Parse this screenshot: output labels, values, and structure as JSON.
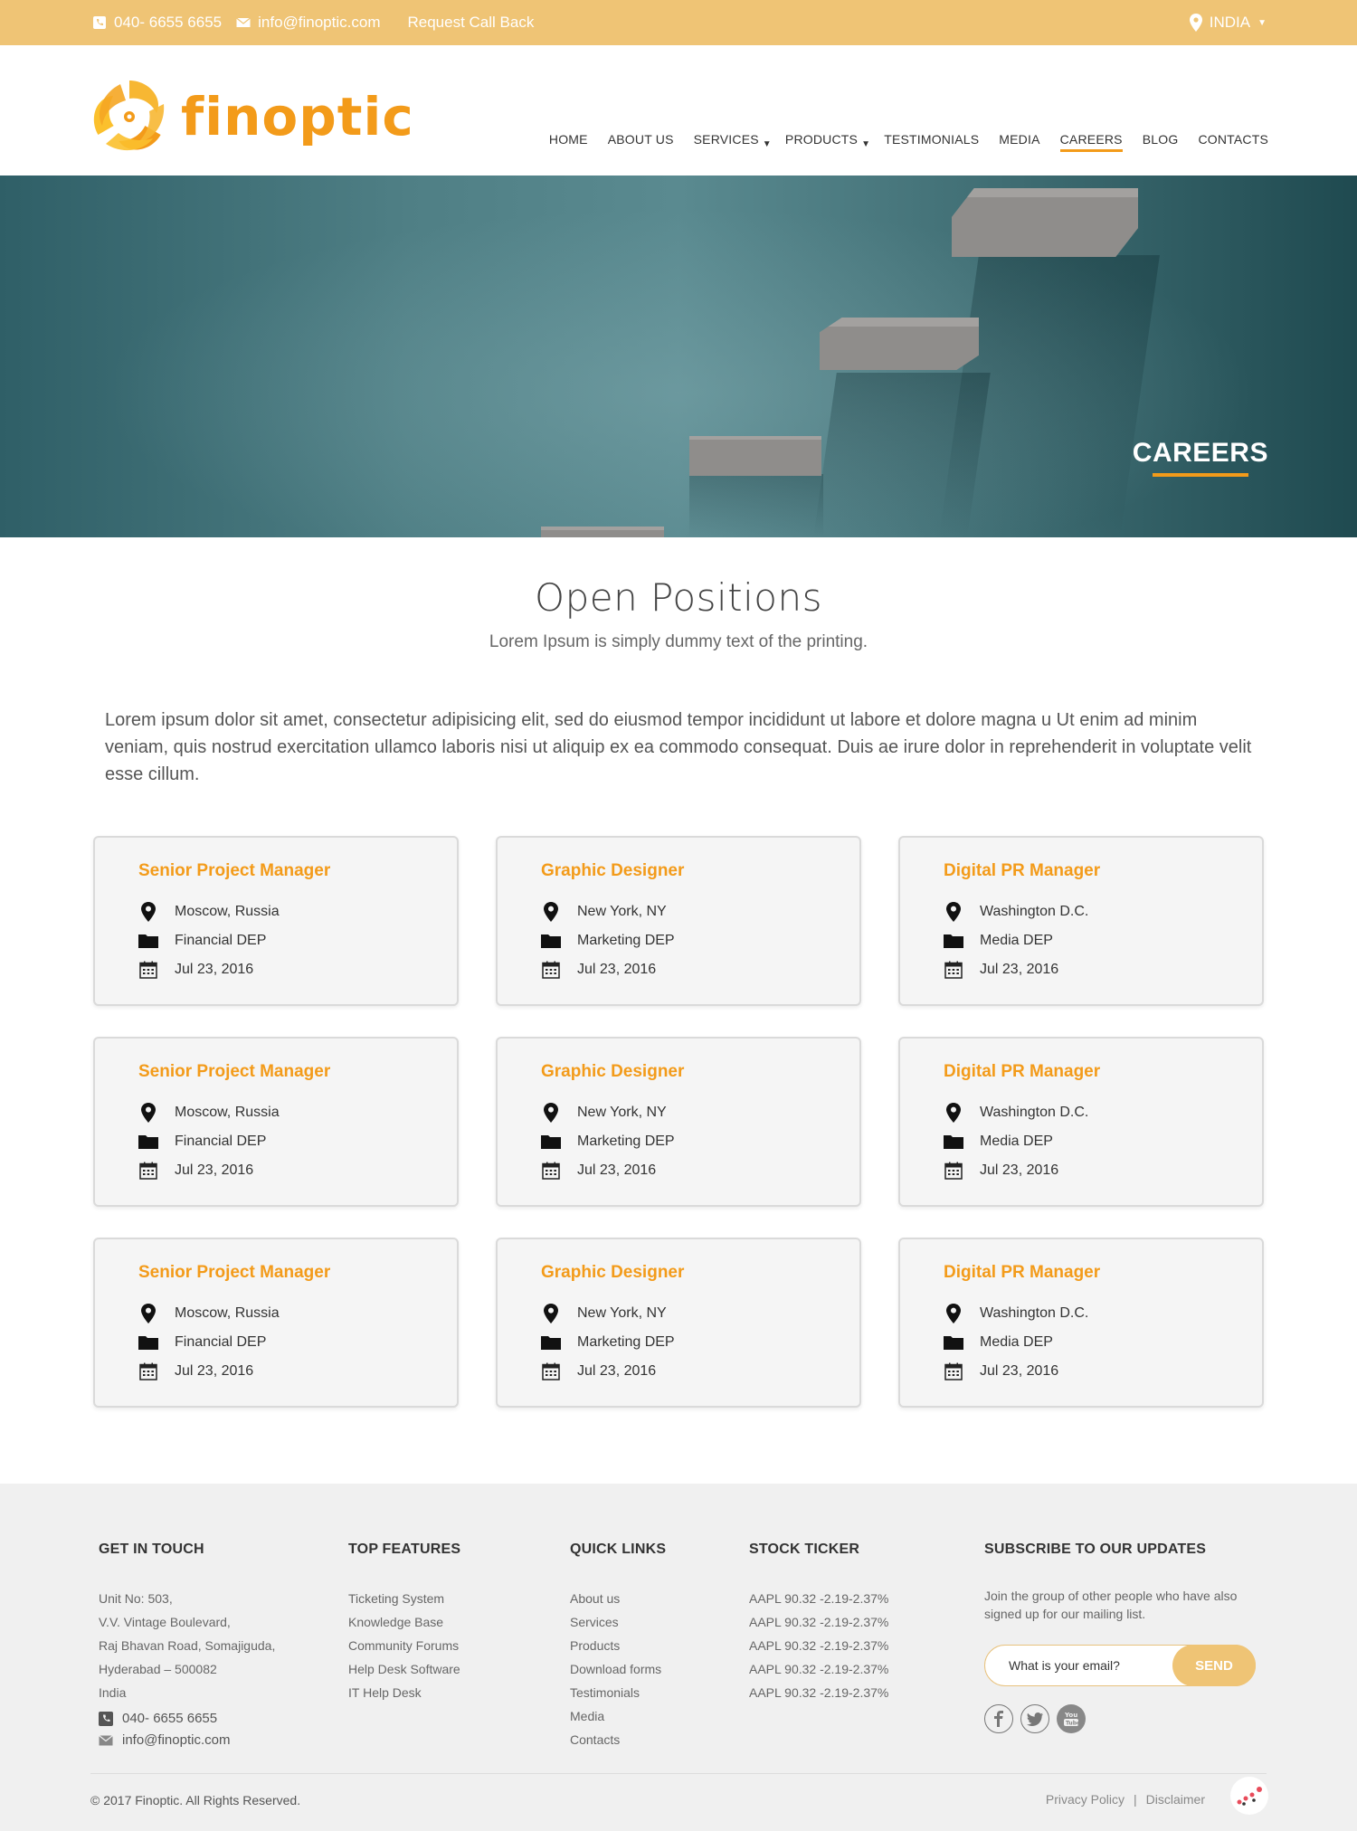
{
  "topbar": {
    "phone": "040- 6655 6655",
    "email": "info@finoptic.com",
    "callback": "Request Call Back",
    "country": "INDIA"
  },
  "brand": {
    "name": "finoptic",
    "color": "#f39b1a",
    "accent": "#efc475"
  },
  "nav": {
    "items": [
      {
        "label": "HOME"
      },
      {
        "label": "ABOUT US"
      },
      {
        "label": "SERVICES"
      },
      {
        "label": "PRODUCTS"
      },
      {
        "label": "TESTIMONIALS"
      },
      {
        "label": "MEDIA"
      },
      {
        "label": "CAREERS"
      },
      {
        "label": "BLOG"
      },
      {
        "label": "CONTACTS"
      }
    ]
  },
  "hero": {
    "title": "CAREERS"
  },
  "positions": {
    "title": "Open Positions",
    "subtitle": "Lorem Ipsum is simply dummy text of the printing.",
    "intro": "Lorem ipsum dolor sit amet, consectetur adipisicing elit, sed do eiusmod tempor incididunt ut labore et dolore  magna u  Ut  enim ad minim veniam, quis nostrud exercitation ullamco laboris nisi ut aliquip ex ea commodo consequat. Duis ae irure dolor in reprehenderit in voluptate velit esse cillum.",
    "cards": [
      {
        "title": "Senior Project Manager",
        "location": "Moscow, Russia",
        "dept": "Financial DEP",
        "date": "Jul 23, 2016"
      },
      {
        "title": "Graphic Designer",
        "location": "New York, NY",
        "dept": "Marketing DEP",
        "date": "Jul 23, 2016"
      },
      {
        "title": "Digital PR Manager",
        "location": "Washington D.C.",
        "dept": "Media DEP",
        "date": "Jul 23, 2016"
      },
      {
        "title": "Senior Project Manager",
        "location": "Moscow, Russia",
        "dept": "Financial DEP",
        "date": "Jul 23, 2016"
      },
      {
        "title": "Graphic Designer",
        "location": "New York, NY",
        "dept": "Marketing DEP",
        "date": "Jul 23, 2016"
      },
      {
        "title": "Digital PR Manager",
        "location": "Washington D.C.",
        "dept": "Media DEP",
        "date": "Jul 23, 2016"
      },
      {
        "title": "Senior Project Manager",
        "location": "Moscow, Russia",
        "dept": "Financial DEP",
        "date": "Jul 23, 2016"
      },
      {
        "title": "Graphic Designer",
        "location": "New York, NY",
        "dept": "Marketing DEP",
        "date": "Jul 23, 2016"
      },
      {
        "title": "Digital PR Manager",
        "location": "Washington D.C.",
        "dept": "Media DEP",
        "date": "Jul 23, 2016"
      }
    ]
  },
  "footer": {
    "contact": {
      "heading": "GET IN TOUCH",
      "address": [
        "Unit No: 503,",
        "V.V. Vintage Boulevard,",
        "Raj Bhavan Road, Somajiguda,",
        "Hyderabad – 500082",
        "India"
      ],
      "phone": "040- 6655 6655",
      "email": "info@finoptic.com"
    },
    "features": {
      "heading": "TOP FEATURES",
      "items": [
        "Ticketing System",
        "Knowledge Base",
        "Community Forums",
        "Help Desk Software",
        "IT Help Desk"
      ]
    },
    "quicklinks": {
      "heading": "QUICK LINKS",
      "items": [
        "About us",
        "Services",
        "Products",
        "Download forms",
        "Testimonials",
        "Media",
        "Contacts"
      ]
    },
    "ticker": {
      "heading": "STOCK TICKER",
      "items": [
        "AAPL 90.32 -2.19-2.37%",
        "AAPL 90.32 -2.19-2.37%",
        "AAPL 90.32 -2.19-2.37%",
        "AAPL 90.32 -2.19-2.37%",
        "AAPL 90.32 -2.19-2.37%"
      ]
    },
    "subscribe": {
      "heading": "SUBSCRIBE TO OUR UPDATES",
      "text": "Join the group of other people who have also signed up for our mailing list.",
      "placeholder": "What is your email?",
      "button": "SEND"
    },
    "socials": [
      "facebook-icon",
      "twitter-icon",
      "youtube-icon"
    ],
    "copyright": "© 2017 Finoptic. All Rights Reserved.",
    "privacy": "Privacy Policy",
    "separator": "|",
    "disclaimer": "Disclaimer"
  }
}
